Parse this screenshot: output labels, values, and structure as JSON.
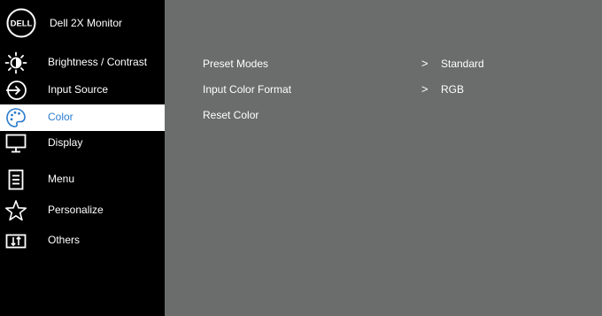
{
  "monitor": {
    "brand_logo": "DELL",
    "model": "Dell 2X Monitor"
  },
  "menu": {
    "items": [
      {
        "label": "Brightness / Contrast",
        "icon": "brightness-icon"
      },
      {
        "label": "Input Source",
        "icon": "input-source-icon"
      },
      {
        "label": "Color",
        "icon": "color-palette-icon",
        "selected": true
      },
      {
        "label": "Display",
        "icon": "display-icon"
      },
      {
        "label": "Menu",
        "icon": "menu-document-icon"
      },
      {
        "label": "Personalize",
        "icon": "star-icon"
      },
      {
        "label": "Others",
        "icon": "others-icon"
      }
    ]
  },
  "color_panel": {
    "options": [
      {
        "label": "Preset Modes",
        "arrow": ">",
        "value": "Standard"
      },
      {
        "label": "Input Color Format",
        "arrow": ">",
        "value": "RGB"
      },
      {
        "label": "Reset Color"
      }
    ]
  },
  "colors": {
    "sidebar_bg": "#000000",
    "content_bg": "#6b6c6c",
    "selected_bg": "#ffffff",
    "selected_text": "#2a7ccc",
    "text": "#ffffff"
  }
}
